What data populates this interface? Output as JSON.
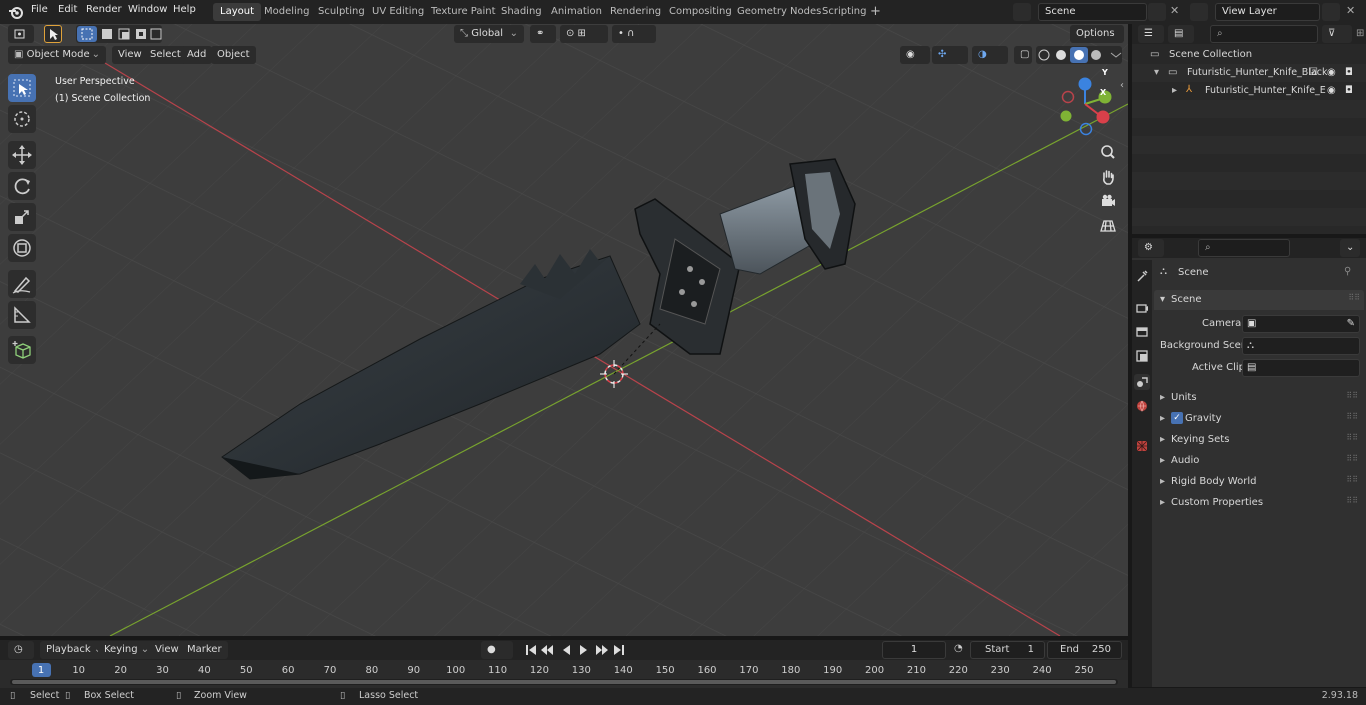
{
  "menu": {
    "file": "File",
    "edit": "Edit",
    "render": "Render",
    "window": "Window",
    "help": "Help"
  },
  "workspaces": [
    "Layout",
    "Modeling",
    "Sculpting",
    "UV Editing",
    "Texture Paint",
    "Shading",
    "Animation",
    "Rendering",
    "Compositing",
    "Geometry Nodes",
    "Scripting"
  ],
  "active_workspace": "Layout",
  "scene_field": "Scene",
  "view_layer_field": "View Layer",
  "viewport": {
    "mode": "Object Mode",
    "menu_view": "View",
    "menu_select": "Select",
    "menu_add": "Add",
    "menu_object": "Object",
    "orientation": "Global",
    "options": "Options",
    "overlay_title": "User Perspective",
    "overlay_collection": "(1) Scene Collection",
    "gizmo_x": "X",
    "gizmo_y": "Y",
    "gizmo_z": "Z"
  },
  "outliner": {
    "root": "Scene Collection",
    "collection": "Futuristic_Hunter_Knife_Black",
    "object": "Futuristic_Hunter_Knife_E"
  },
  "properties": {
    "header": "Scene",
    "section": "Scene",
    "camera_label": "Camera",
    "background_label": "Background Scene",
    "clip_label": "Active Clip",
    "panels": [
      "Units",
      "Gravity",
      "Keying Sets",
      "Audio",
      "Rigid Body World",
      "Custom Properties"
    ]
  },
  "timeline": {
    "playback": "Playback",
    "keying": "Keying",
    "view": "View",
    "marker": "Marker",
    "current_frame": "1",
    "start_label": "Start",
    "start_value": "1",
    "end_label": "End",
    "end_value": "250",
    "ticks": [
      "1",
      "10",
      "20",
      "30",
      "40",
      "50",
      "60",
      "70",
      "80",
      "90",
      "100",
      "110",
      "120",
      "130",
      "140",
      "150",
      "160",
      "170",
      "180",
      "190",
      "200",
      "210",
      "220",
      "230",
      "240",
      "250"
    ]
  },
  "status": {
    "select": "Select",
    "box_select": "Box Select",
    "zoom_view": "Zoom View",
    "lasso_select": "Lasso Select",
    "version": "2.93.18"
  },
  "colors": {
    "accent": "#4772b3",
    "x_axis": "#d9404a",
    "y_axis": "#7fb335",
    "z_axis": "#3b83e0"
  }
}
